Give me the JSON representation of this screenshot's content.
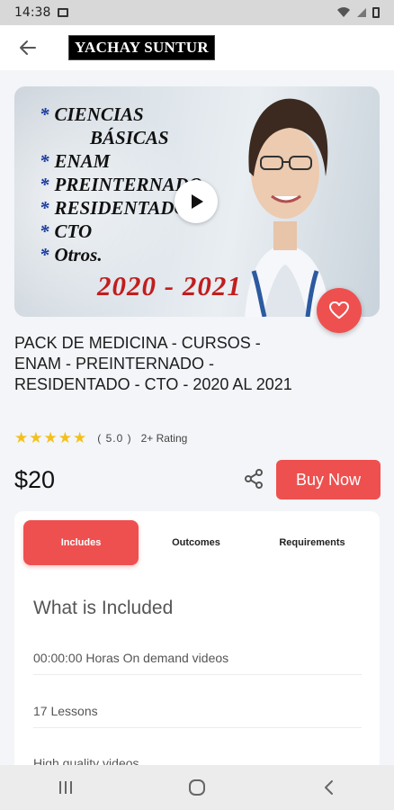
{
  "status_bar": {
    "time": "14:38",
    "icons": [
      "gallery-icon",
      "wifi-icon",
      "signal-icon",
      "battery-icon"
    ]
  },
  "app_bar": {
    "back_icon": "arrow-left-icon",
    "logo_text": "YACHAY SUNTUR"
  },
  "hero": {
    "lines": [
      "CIENCIAS",
      "BÁSICAS",
      "ENAM",
      "PREINTERNADO",
      "RESIDENTADO",
      "CTO",
      "Otros."
    ],
    "star": "*",
    "year_text": "2020 - 2021",
    "play_icon": "play-icon",
    "favorite_icon": "heart-icon"
  },
  "course": {
    "title": "PACK DE MEDICINA - CURSOS - ENAM - PREINTERNADO - RESIDENTADO - CTO - 2020 AL 2021",
    "rating_value": "( 5.0 )",
    "rating_count": "2+ Rating",
    "stars": 5,
    "price": "$20",
    "buy_label": "Buy Now",
    "share_icon": "share-icon"
  },
  "tabs": [
    {
      "label": "Includes",
      "active": true
    },
    {
      "label": "Outcomes",
      "active": false
    },
    {
      "label": "Requirements",
      "active": false
    }
  ],
  "includes": {
    "heading": "What is Included",
    "items": [
      "00:00:00 Horas On demand videos",
      "17 Lessons",
      "High quality videos"
    ]
  },
  "nav_bar": {
    "icons": [
      "recent-apps-icon",
      "home-icon",
      "back-icon"
    ]
  },
  "colors": {
    "accent": "#ee5050",
    "star": "#f3c01c",
    "year": "#c21d1d"
  }
}
